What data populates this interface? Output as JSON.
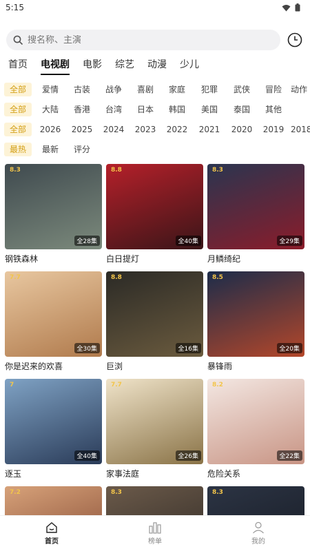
{
  "status": {
    "time": "5:15"
  },
  "search": {
    "placeholder": "搜名称、主演"
  },
  "main_tabs": [
    "首页",
    "电视剧",
    "电影",
    "综艺",
    "动漫",
    "少儿"
  ],
  "active_main_tab": 1,
  "filters": {
    "genre": [
      "全部",
      "爱情",
      "古装",
      "战争",
      "喜剧",
      "家庭",
      "犯罪",
      "武侠",
      "冒险",
      "动作"
    ],
    "region": [
      "全部",
      "大陆",
      "香港",
      "台湾",
      "日本",
      "韩国",
      "美国",
      "泰国",
      "其他"
    ],
    "year": [
      "全部",
      "2026",
      "2025",
      "2024",
      "2023",
      "2022",
      "2021",
      "2020",
      "2019",
      "2018"
    ],
    "sort": [
      "最热",
      "最新",
      "评分"
    ]
  },
  "cards": [
    {
      "title": "钢铁森林",
      "rating": "8.3",
      "episodes": "全28集",
      "bg": [
        "#3f4a4f",
        "#7c8a7c"
      ]
    },
    {
      "title": "白日提灯",
      "rating": "8.8",
      "episodes": "全40集",
      "bg": [
        "#b5202a",
        "#3a1518"
      ]
    },
    {
      "title": "月鳞绮纪",
      "rating": "8.3",
      "episodes": "全29集",
      "bg": [
        "#2a3550",
        "#8b1c2a"
      ]
    },
    {
      "title": "你是迟来的欢喜",
      "rating": "7.7",
      "episodes": "全30集",
      "bg": [
        "#e8c7a0",
        "#b07a4c"
      ]
    },
    {
      "title": "巨浏",
      "rating": "8.8",
      "episodes": "全16集",
      "bg": [
        "#2b2a26",
        "#6b5b3e"
      ]
    },
    {
      "title": "暴锋雨",
      "rating": "8.5",
      "episodes": "全20集",
      "bg": [
        "#1c2c4a",
        "#b4472a"
      ]
    },
    {
      "title": "逐玉",
      "rating": "7",
      "episodes": "全40集",
      "bg": [
        "#7fa2c4",
        "#2a3b58"
      ]
    },
    {
      "title": "家事法庭",
      "rating": "7.7",
      "episodes": "全26集",
      "bg": [
        "#efe3c9",
        "#8a7347"
      ]
    },
    {
      "title": "危险关系",
      "rating": "8.2",
      "episodes": "全22集",
      "bg": [
        "#f3e7e2",
        "#c89484"
      ]
    },
    {
      "title": "",
      "rating": "7.2",
      "episodes": "",
      "bg": [
        "#d7a27a",
        "#7a3f2a"
      ]
    },
    {
      "title": "",
      "rating": "8.3",
      "episodes": "",
      "bg": [
        "#6b5a4a",
        "#2b2622"
      ]
    },
    {
      "title": "",
      "rating": "8.3",
      "episodes": "",
      "bg": [
        "#2c3444",
        "#141820"
      ]
    }
  ],
  "bottom_nav": [
    {
      "label": "首页",
      "icon": "home-icon"
    },
    {
      "label": "榜单",
      "icon": "chart-icon"
    },
    {
      "label": "我的",
      "icon": "user-icon"
    }
  ],
  "colors": {
    "accent": "#d4a018",
    "chip_bg": "#fdf3d7",
    "rating": "#f3c54a"
  }
}
